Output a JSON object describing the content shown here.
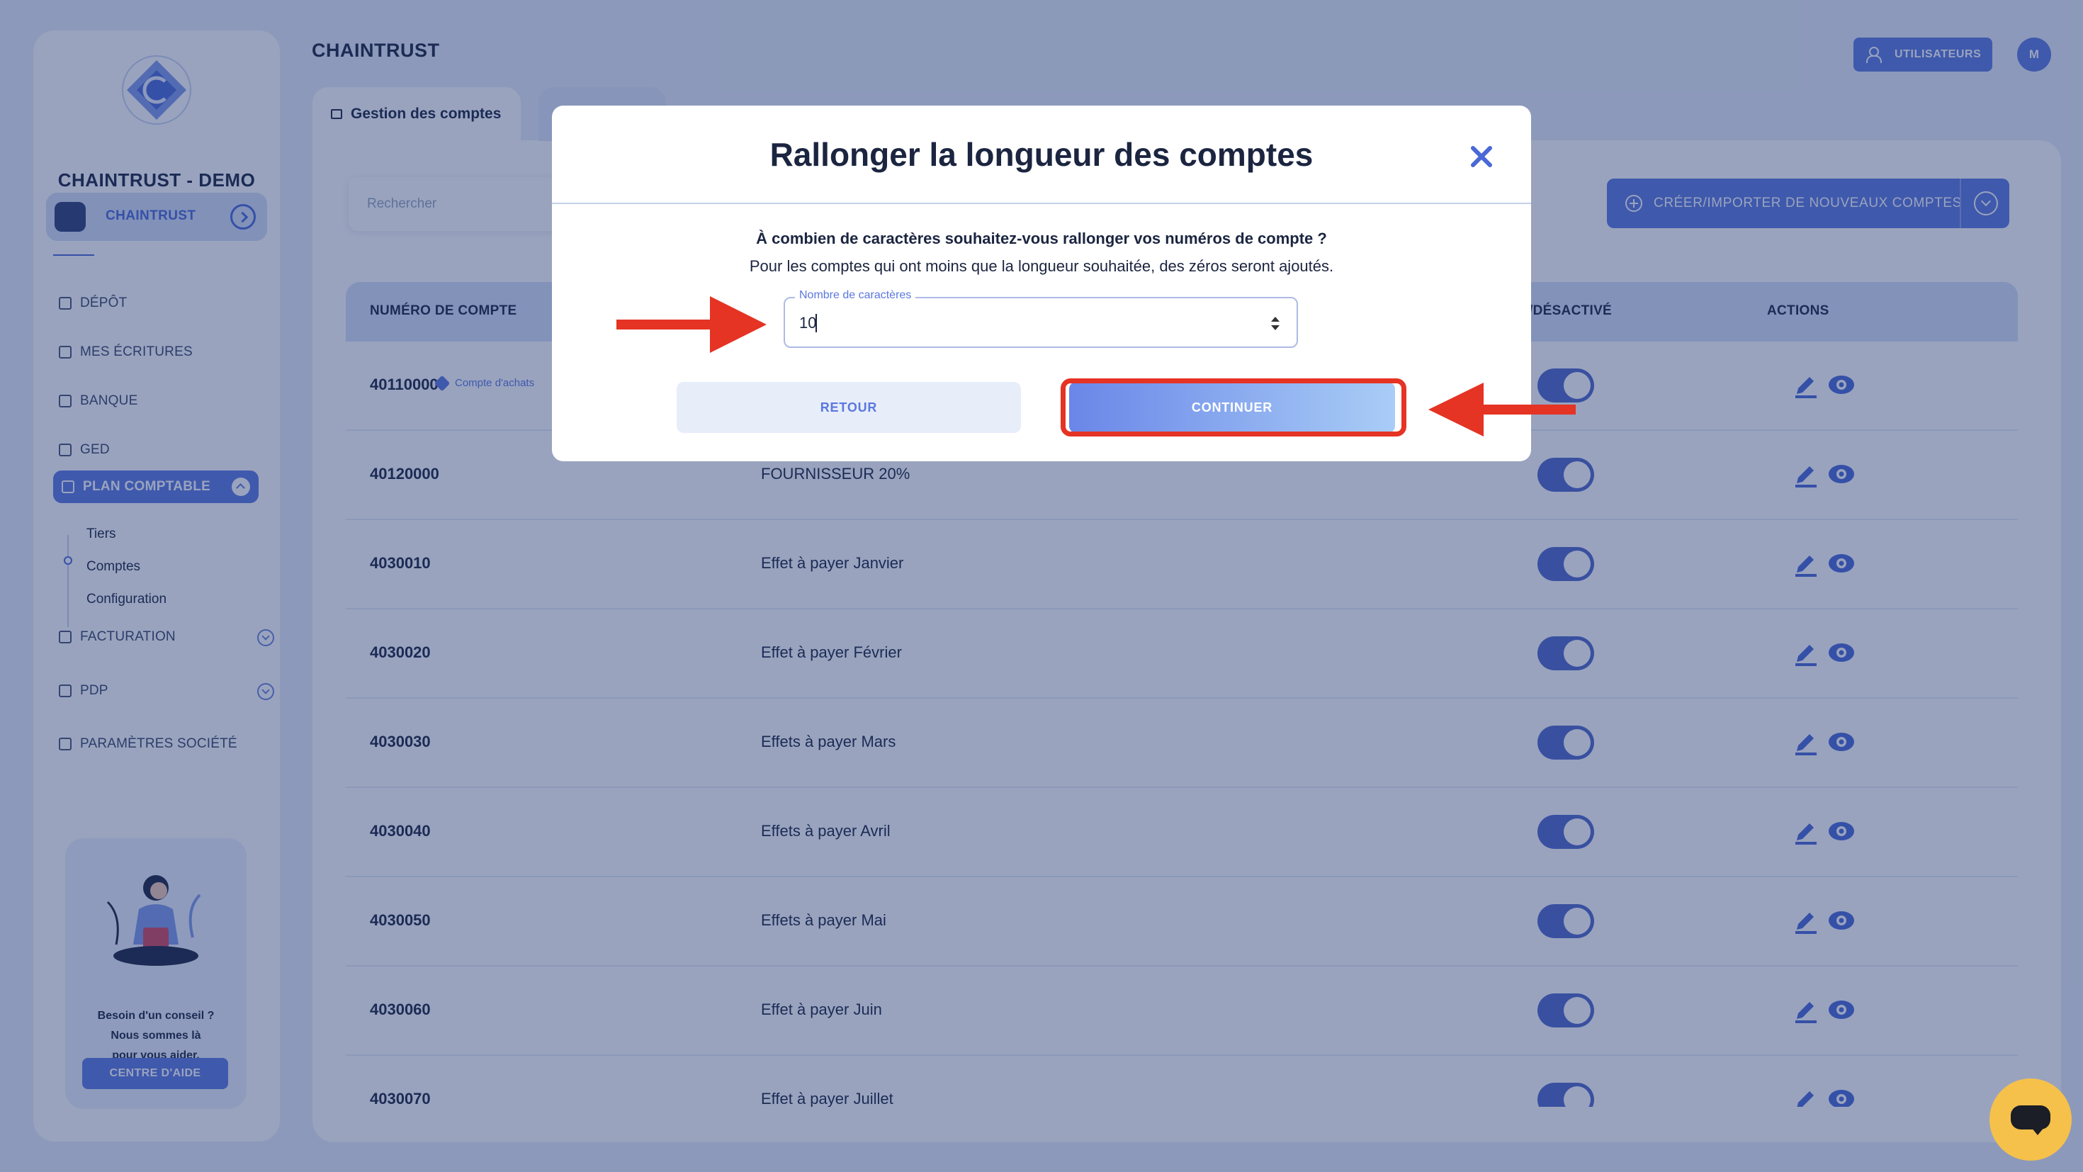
{
  "company": {
    "name": "CHAINTRUST - DEMO",
    "org_name": "CHAINTRUST"
  },
  "sidebar": {
    "items": [
      {
        "label": "DÉPÔT"
      },
      {
        "label": "MES ÉCRITURES"
      },
      {
        "label": "BANQUE"
      },
      {
        "label": "GED"
      },
      {
        "label": "PLAN COMPTABLE"
      },
      {
        "label": "FACTURATION"
      },
      {
        "label": "PDP"
      },
      {
        "label": "PARAMÈTRES SOCIÉTÉ"
      }
    ],
    "sub_items": [
      {
        "label": "Tiers"
      },
      {
        "label": "Comptes"
      },
      {
        "label": "Configuration"
      }
    ],
    "help": {
      "line1": "Besoin d'un conseil ?",
      "line2": "Nous sommes là",
      "line3": "pour vous aider.",
      "button": "CENTRE D'AIDE"
    }
  },
  "header": {
    "title": "CHAINTRUST",
    "users_button": "UTILISATEURS",
    "avatar_initial": "M"
  },
  "tabs": [
    {
      "label": "Gestion des comptes"
    },
    {
      "label": ""
    }
  ],
  "search": {
    "placeholder": "Rechercher"
  },
  "create_button": "CRÉER/IMPORTER DE NOUVEAUX COMPTES",
  "table": {
    "columns": {
      "number": "NUMÉRO DE COMPTE",
      "status": "/DÉSACTIVÉ",
      "actions": "ACTIONS"
    },
    "rows": [
      {
        "number": "40110000",
        "tag": "Compte d'achats",
        "label": ""
      },
      {
        "number": "40120000",
        "tag": "",
        "label": "FOURNISSEUR 20%"
      },
      {
        "number": "4030010",
        "tag": "",
        "label": "Effet à payer Janvier"
      },
      {
        "number": "4030020",
        "tag": "",
        "label": "Effet à payer Février"
      },
      {
        "number": "4030030",
        "tag": "",
        "label": "Effets à payer Mars"
      },
      {
        "number": "4030040",
        "tag": "",
        "label": "Effets à payer Avril"
      },
      {
        "number": "4030050",
        "tag": "",
        "label": "Effets à payer Mai"
      },
      {
        "number": "4030060",
        "tag": "",
        "label": "Effet à payer Juin"
      },
      {
        "number": "4030070",
        "tag": "",
        "label": "Effet à payer Juillet"
      }
    ]
  },
  "modal": {
    "title": "Rallonger la longueur des comptes",
    "question": "À combien de caractères souhaitez-vous rallonger vos numéros de compte ?",
    "info": "Pour les comptes qui ont moins que la longueur souhaitée, des zéros seront ajoutés.",
    "field_label": "Nombre de caractères",
    "field_value": "10",
    "back_button": "RETOUR",
    "continue_button": "CONTINUER"
  },
  "colors": {
    "accent": "#5b78de",
    "annotation": "#e53324",
    "chat": "#f5c14a"
  }
}
